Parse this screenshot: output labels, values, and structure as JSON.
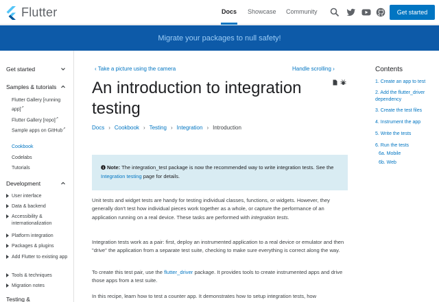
{
  "header": {
    "logo_text": "Flutter",
    "nav": [
      "Docs",
      "Showcase",
      "Community"
    ],
    "cta_label": "Get started",
    "icons": [
      "search-icon",
      "twitter-icon",
      "youtube-icon",
      "github-icon"
    ]
  },
  "banner": {
    "text": "Migrate your packages to null safety!"
  },
  "sidebar": {
    "get_started": "Get started",
    "samples": "Samples & tutorials",
    "samples_items": [
      "Flutter Gallery [running app]",
      "Flutter Gallery [repo]",
      "Sample apps on GitHub",
      "Cookbook",
      "Codelabs",
      "Tutorials"
    ],
    "development": "Development",
    "dev_items": [
      "User interface",
      "Data & backend",
      "Accessibility & internationalization",
      "Platform integration",
      "Packages & plugins",
      "Add Flutter to existing app",
      "Tools & techniques",
      "Migration notes"
    ],
    "testing": "Testing &"
  },
  "main": {
    "prev_link": "Take a picture using the camera",
    "next_link": "Handle scrolling",
    "title": "An introduction to integration testing",
    "breadcrumbs": [
      "Docs",
      "Cookbook",
      "Testing",
      "Integration",
      "Introduction"
    ],
    "note": {
      "label": "Note:",
      "text_1": "The integration_test package is now the recommended way to write integration tests. See the",
      "link": "Integration testing",
      "text_2": "page for details."
    },
    "p1_text": "Unit tests and widget tests are handy for testing individual classes, functions, or widgets. However, they generally don't test how individual pieces work together as a whole, or capture the performance of an application running on a real device. These tasks are performed with",
    "p1_italic": "integration tests",
    "p1_end": ".",
    "p2": "Integration tests work as a pair: first, deploy an instrumented application to a real device or emulator and then \"drive\" the application from a separate test suite, checking to make sure everything is correct along the way.",
    "p3_text_1": "To create this test pair, use the",
    "p3_link": "flutter_driver",
    "p3_text_2": "package. It provides tools to create instrumented apps and drive those apps from a test suite.",
    "p4": "In this recipe, learn how to test a counter app. It demonstrates how to setup integration tests, how"
  },
  "toc": {
    "title": "Contents",
    "items": [
      "1. Create an app to test",
      "2. Add the flutter_driver dependency",
      "3. Create the test files",
      "4. Instrument the app",
      "5. Write the tests",
      "6. Run the tests"
    ],
    "sub_items": [
      "6a. Mobile",
      "6b. Web"
    ]
  },
  "colors": {
    "accent": "#0175c2",
    "banner": "#0d5aa8",
    "note_bg": "#d9ecf3"
  }
}
